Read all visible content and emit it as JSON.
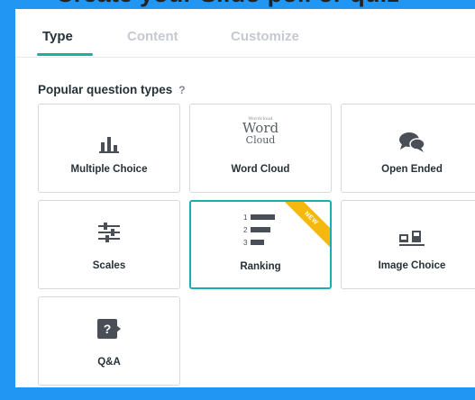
{
  "header": {
    "clipped_text": "Create your Slido poll or quiz"
  },
  "tabs": [
    {
      "label": "Type"
    },
    {
      "label": "Content"
    },
    {
      "label": "Customize"
    }
  ],
  "section": {
    "title": "Popular question types",
    "help": "?"
  },
  "cards": [
    {
      "label": "Multiple Choice",
      "icon": "bar-chart-icon"
    },
    {
      "label": "Word Cloud",
      "icon": "word-cloud-icon",
      "icon_text": {
        "big1": "Word",
        "big2": "Cloud",
        "small": "Wordcloud"
      }
    },
    {
      "label": "Open Ended",
      "icon": "speech-bubbles-icon"
    },
    {
      "label": "Scales",
      "icon": "sliders-icon"
    },
    {
      "label": "Ranking",
      "icon": "ranking-icon",
      "badge": "NEW",
      "selected": true,
      "icon_numbers": [
        "1",
        "2",
        "3"
      ]
    },
    {
      "label": "Image Choice",
      "icon": "image-choice-icon"
    },
    {
      "label": "Q&A",
      "icon": "question-icon",
      "icon_text": "?"
    }
  ],
  "colors": {
    "accent": "#13b2a6",
    "selected_border": "#19aeb5",
    "badge": "#f5b80f",
    "frame": "#2196f3",
    "icon": "#4a4f57"
  }
}
